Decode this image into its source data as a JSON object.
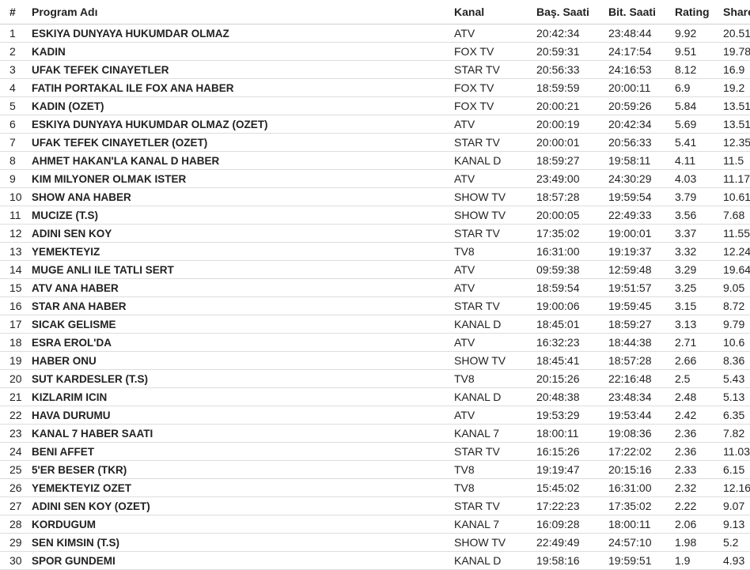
{
  "table": {
    "headers": {
      "num": "#",
      "program": "Program Adı",
      "channel": "Kanal",
      "start": "Baş. Saati",
      "end": "Bit. Saati",
      "rating": "Rating",
      "share": "Share"
    },
    "rows": [
      {
        "num": "1",
        "program": "ESKIYA DUNYAYA HUKUMDAR OLMAZ",
        "channel": "ATV",
        "start": "20:42:34",
        "end": "23:48:44",
        "rating": "9.92",
        "share": "20.51"
      },
      {
        "num": "2",
        "program": "KADIN",
        "channel": "FOX TV",
        "start": "20:59:31",
        "end": "24:17:54",
        "rating": "9.51",
        "share": "19.78"
      },
      {
        "num": "3",
        "program": "UFAK TEFEK CINAYETLER",
        "channel": "STAR TV",
        "start": "20:56:33",
        "end": "24:16:53",
        "rating": "8.12",
        "share": "16.9"
      },
      {
        "num": "4",
        "program": "FATIH PORTAKAL ILE FOX ANA HABER",
        "channel": "FOX TV",
        "start": "18:59:59",
        "end": "20:00:11",
        "rating": "6.9",
        "share": "19.2"
      },
      {
        "num": "5",
        "program": "KADIN (OZET)",
        "channel": "FOX TV",
        "start": "20:00:21",
        "end": "20:59:26",
        "rating": "5.84",
        "share": "13.51"
      },
      {
        "num": "6",
        "program": "ESKIYA DUNYAYA HUKUMDAR OLMAZ (OZET)",
        "channel": "ATV",
        "start": "20:00:19",
        "end": "20:42:34",
        "rating": "5.69",
        "share": "13.51"
      },
      {
        "num": "7",
        "program": "UFAK TEFEK CINAYETLER (OZET)",
        "channel": "STAR TV",
        "start": "20:00:01",
        "end": "20:56:33",
        "rating": "5.41",
        "share": "12.35"
      },
      {
        "num": "8",
        "program": "AHMET HAKAN'LA KANAL D HABER",
        "channel": "KANAL D",
        "start": "18:59:27",
        "end": "19:58:11",
        "rating": "4.11",
        "share": "11.5"
      },
      {
        "num": "9",
        "program": "KIM MILYONER OLMAK ISTER",
        "channel": "ATV",
        "start": "23:49:00",
        "end": "24:30:29",
        "rating": "4.03",
        "share": "11.17"
      },
      {
        "num": "10",
        "program": "SHOW ANA HABER",
        "channel": "SHOW TV",
        "start": "18:57:28",
        "end": "19:59:54",
        "rating": "3.79",
        "share": "10.61"
      },
      {
        "num": "11",
        "program": "MUCIZE (T.S)",
        "channel": "SHOW TV",
        "start": "20:00:05",
        "end": "22:49:33",
        "rating": "3.56",
        "share": "7.68"
      },
      {
        "num": "12",
        "program": "ADINI SEN KOY",
        "channel": "STAR TV",
        "start": "17:35:02",
        "end": "19:00:01",
        "rating": "3.37",
        "share": "11.55"
      },
      {
        "num": "13",
        "program": "YEMEKTEYIZ",
        "channel": "TV8",
        "start": "16:31:00",
        "end": "19:19:37",
        "rating": "3.32",
        "share": "12.24"
      },
      {
        "num": "14",
        "program": "MUGE ANLI ILE TATLI SERT",
        "channel": "ATV",
        "start": "09:59:38",
        "end": "12:59:48",
        "rating": "3.29",
        "share": "19.64"
      },
      {
        "num": "15",
        "program": "ATV ANA HABER",
        "channel": "ATV",
        "start": "18:59:54",
        "end": "19:51:57",
        "rating": "3.25",
        "share": "9.05"
      },
      {
        "num": "16",
        "program": "STAR ANA HABER",
        "channel": "STAR TV",
        "start": "19:00:06",
        "end": "19:59:45",
        "rating": "3.15",
        "share": "8.72"
      },
      {
        "num": "17",
        "program": "SICAK GELISME",
        "channel": "KANAL D",
        "start": "18:45:01",
        "end": "18:59:27",
        "rating": "3.13",
        "share": "9.79"
      },
      {
        "num": "18",
        "program": "ESRA EROL'DA",
        "channel": "ATV",
        "start": "16:32:23",
        "end": "18:44:38",
        "rating": "2.71",
        "share": "10.6"
      },
      {
        "num": "19",
        "program": "HABER ONU",
        "channel": "SHOW TV",
        "start": "18:45:41",
        "end": "18:57:28",
        "rating": "2.66",
        "share": "8.36"
      },
      {
        "num": "20",
        "program": "SUT KARDESLER (T.S)",
        "channel": "TV8",
        "start": "20:15:26",
        "end": "22:16:48",
        "rating": "2.5",
        "share": "5.43"
      },
      {
        "num": "21",
        "program": "KIZLARIM ICIN",
        "channel": "KANAL D",
        "start": "20:48:38",
        "end": "23:48:34",
        "rating": "2.48",
        "share": "5.13"
      },
      {
        "num": "22",
        "program": "HAVA DURUMU",
        "channel": "ATV",
        "start": "19:53:29",
        "end": "19:53:44",
        "rating": "2.42",
        "share": "6.35"
      },
      {
        "num": "23",
        "program": "KANAL 7 HABER SAATI",
        "channel": "KANAL 7",
        "start": "18:00:11",
        "end": "19:08:36",
        "rating": "2.36",
        "share": "7.82"
      },
      {
        "num": "24",
        "program": "BENI AFFET",
        "channel": "STAR TV",
        "start": "16:15:26",
        "end": "17:22:02",
        "rating": "2.36",
        "share": "11.03"
      },
      {
        "num": "25",
        "program": "5'ER BESER (TKR)",
        "channel": "TV8",
        "start": "19:19:47",
        "end": "20:15:16",
        "rating": "2.33",
        "share": "6.15"
      },
      {
        "num": "26",
        "program": "YEMEKTEYIZ OZET",
        "channel": "TV8",
        "start": "15:45:02",
        "end": "16:31:00",
        "rating": "2.32",
        "share": "12.16"
      },
      {
        "num": "27",
        "program": "ADINI SEN KOY (OZET)",
        "channel": "STAR TV",
        "start": "17:22:23",
        "end": "17:35:02",
        "rating": "2.22",
        "share": "9.07"
      },
      {
        "num": "28",
        "program": "KORDUGUM",
        "channel": "KANAL 7",
        "start": "16:09:28",
        "end": "18:00:11",
        "rating": "2.06",
        "share": "9.13"
      },
      {
        "num": "29",
        "program": "SEN KIMSIN (T.S)",
        "channel": "SHOW TV",
        "start": "22:49:49",
        "end": "24:57:10",
        "rating": "1.98",
        "share": "5.2"
      },
      {
        "num": "30",
        "program": "SPOR GUNDEMI",
        "channel": "KANAL D",
        "start": "19:58:16",
        "end": "19:59:51",
        "rating": "1.9",
        "share": "4.93"
      }
    ]
  }
}
